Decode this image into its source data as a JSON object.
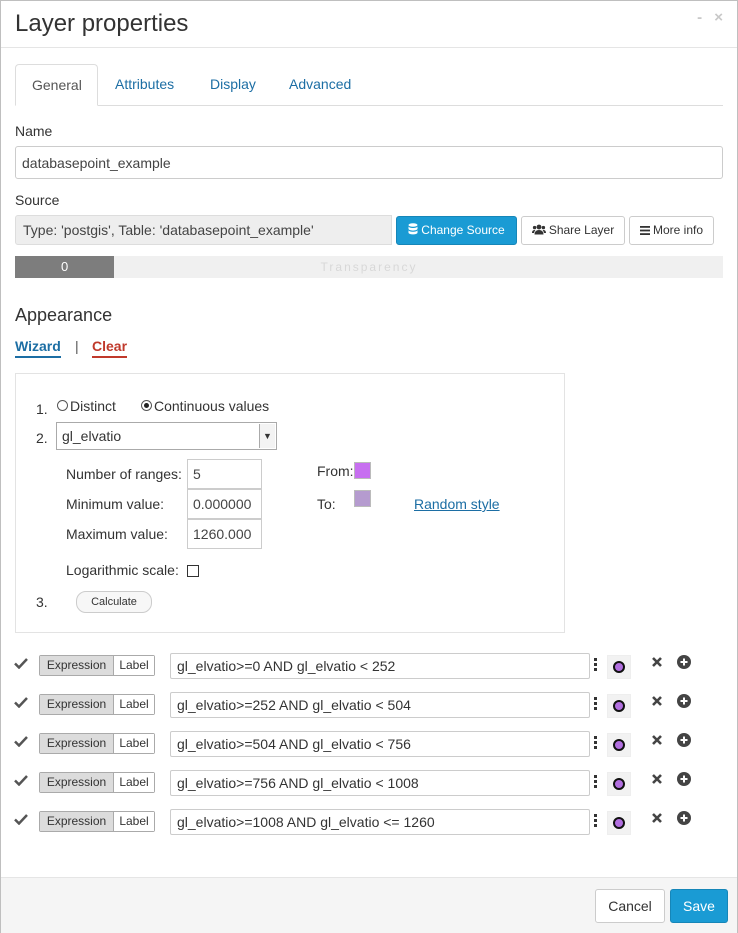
{
  "dialog": {
    "title": "Layer properties",
    "minimize_glyph": "-",
    "close_glyph": "×"
  },
  "tabs": [
    {
      "label": "General",
      "active": true
    },
    {
      "label": "Attributes",
      "active": false
    },
    {
      "label": "Display",
      "active": false
    },
    {
      "label": "Advanced",
      "active": false
    }
  ],
  "general": {
    "name_label": "Name",
    "name_value": "databasepoint_example",
    "source_label": "Source",
    "source_value": "Type: 'postgis', Table: 'databasepoint_example'",
    "change_source_label": "Change Source",
    "share_layer_label": "Share Layer",
    "more_info_label": "More info",
    "transparency_value": "0",
    "transparency_fraction": 0.14,
    "transparency_label": "Transparency"
  },
  "appearance": {
    "title": "Appearance",
    "wizard_label": "Wizard",
    "separator": "|",
    "clear_label": "Clear",
    "step1": "1.",
    "distinct_label": "Distinct",
    "continuous_label": "Continuous values",
    "selected_mode": "continuous",
    "step2": "2.",
    "attribute_value": "gl_elvatio",
    "num_ranges_label": "Number of ranges:",
    "num_ranges_value": "5",
    "min_label": "Minimum value:",
    "min_value": "0.000000",
    "max_label": "Maximum value:",
    "max_value": "1260.000",
    "from_label": "From:",
    "from_color": "#c76ff0",
    "to_label": "To:",
    "to_color": "#b59bcf",
    "random_style_label": "Random style",
    "log_scale_label": "Logarithmic scale:",
    "log_scale_checked": false,
    "step3": "3.",
    "calculate_label": "Calculate"
  },
  "rules": [
    {
      "expression_label": "Expression",
      "label_label": "Label",
      "value": "gl_elvatio>=0 AND gl_elvatio < 252"
    },
    {
      "expression_label": "Expression",
      "label_label": "Label",
      "value": "gl_elvatio>=252 AND gl_elvatio < 504"
    },
    {
      "expression_label": "Expression",
      "label_label": "Label",
      "value": "gl_elvatio>=504 AND gl_elvatio < 756"
    },
    {
      "expression_label": "Expression",
      "label_label": "Label",
      "value": "gl_elvatio>=756 AND gl_elvatio < 1008"
    },
    {
      "expression_label": "Expression",
      "label_label": "Label",
      "value": "gl_elvatio>=1008 AND gl_elvatio <= 1260"
    }
  ],
  "footer": {
    "cancel_label": "Cancel",
    "save_label": "Save"
  },
  "colors": {
    "primary": "#1a9bd4",
    "link": "#1c6ea4",
    "danger": "#c0392b"
  }
}
